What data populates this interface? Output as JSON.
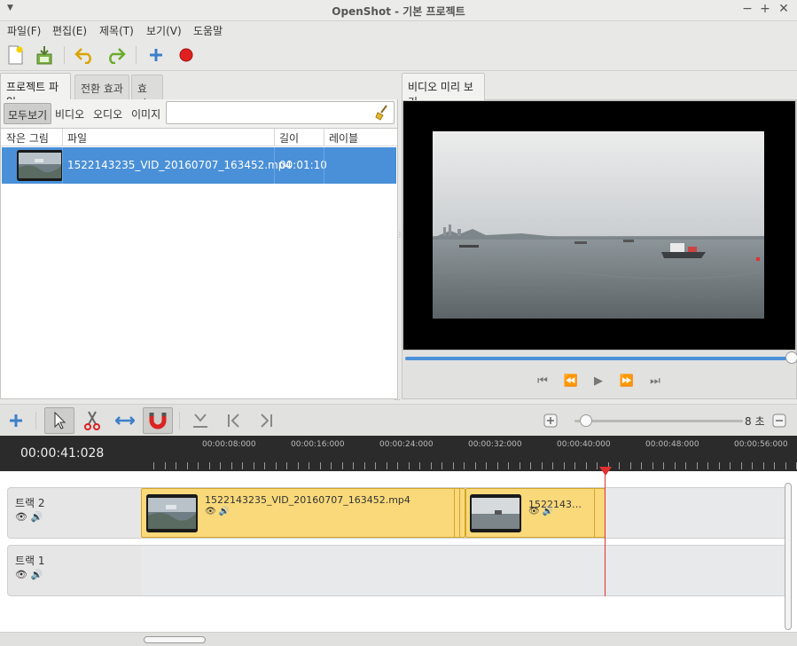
{
  "window": {
    "title": "OpenShot - 기본 프로젝트",
    "menu_arrow": "▼",
    "minimize": "−",
    "maximize": "+",
    "close": "✕"
  },
  "menubar": {
    "items": [
      "파일(F)",
      "편집(E)",
      "제목(T)",
      "보기(V)",
      "도움말"
    ]
  },
  "toolbar": {
    "icons": [
      "new-project-icon",
      "save-project-icon",
      "undo-icon",
      "redo-icon",
      "import-files-icon",
      "export-video-icon"
    ]
  },
  "left_panel": {
    "tabs": [
      "프로젝트 파일",
      "전환 효과",
      "효과"
    ],
    "active_tab": "프로젝트 파일",
    "filters": [
      "모두보기",
      "비디오",
      "오디오",
      "이미지"
    ],
    "active_filter": "모두보기",
    "search": {
      "value": "",
      "placeholder": ""
    },
    "columns": [
      "작은 그림",
      "파일",
      "길이",
      "레이블"
    ],
    "files": [
      {
        "name": "1522143235_VID_20160707_163452.mp4",
        "length": "00:01:10",
        "label": ""
      }
    ]
  },
  "right_panel": {
    "tab": "비디오 미리 보기",
    "seek_fraction": 1.0,
    "controls": [
      "⏮",
      "⏪",
      "▶",
      "⏩",
      "⏭"
    ]
  },
  "timeline_toolbar": {
    "zoom_label": "8 초",
    "zoom_fraction": 0.03
  },
  "ruler": {
    "timecode": "00:00:41:028",
    "labels": [
      "00:00:08:000",
      "00:00:16:000",
      "00:00:24:000",
      "00:00:32:000",
      "00:00:40:000",
      "00:00:48:000",
      "00:00:56:000"
    ]
  },
  "tracks": [
    {
      "name": "트랙 2",
      "clips": [
        {
          "name": "1522143235_VID_20160707_163452.mp4"
        },
        {
          "name": "1522143…"
        }
      ]
    },
    {
      "name": "트랙 1",
      "clips": []
    }
  ],
  "colors": {
    "selection": "#4a90d9",
    "clip": "#f9d97a",
    "playhead": "#e03030",
    "ruler_bg": "#2b2b2b"
  }
}
